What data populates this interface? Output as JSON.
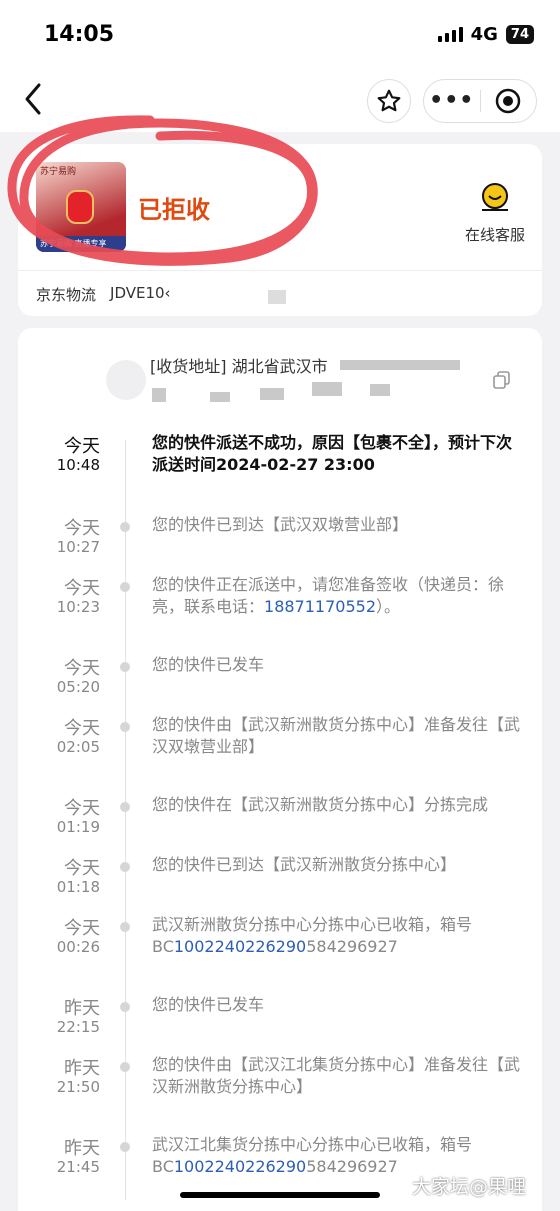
{
  "status_bar": {
    "time": "14:05",
    "network": "4G",
    "battery": "74"
  },
  "order": {
    "thumbnail_top_text": "苏宁易购",
    "thumbnail_band_text": "苏宁易购 直播专享",
    "status": "已拒收",
    "customer_service_label": "在线客服",
    "carrier": "京东物流",
    "tracking_no": "JDVE10‹"
  },
  "address": {
    "text": "[收货地址] 湖北省武汉市"
  },
  "colors": {
    "status_orange": "#e04a10",
    "link_blue": "#2c5db8",
    "scribble_red": "#e84b55"
  },
  "timeline": [
    {
      "day": "今天",
      "time": "10:48",
      "text": "您的快件派送不成功，原因【包裹不全】，预计下次派送时间2024-02-27 23:00"
    },
    {
      "day": "今天",
      "time": "10:27",
      "text": "您的快件已到达【武汉双墩营业部】"
    },
    {
      "day": "今天",
      "time": "10:23",
      "text": "您的快件正在派送中，请您准备签收（快递员：徐亮，联系电话：",
      "link": "18871170552",
      "text_after": "）。"
    },
    {
      "day": "今天",
      "time": "05:20",
      "text": "您的快件已发车"
    },
    {
      "day": "今天",
      "time": "02:05",
      "text": "您的快件由【武汉新洲散货分拣中心】准备发往【武汉双墩营业部】"
    },
    {
      "day": "今天",
      "time": "01:19",
      "text": "您的快件在【武汉新洲散货分拣中心】分拣完成"
    },
    {
      "day": "今天",
      "time": "01:18",
      "text": "您的快件已到达【武汉新洲散货分拣中心】"
    },
    {
      "day": "今天",
      "time": "00:26",
      "text": "武汉新洲散货分拣中心分拣中心已收箱，箱号BC",
      "link": "1002240226290",
      "text_after": "584296927"
    },
    {
      "day": "昨天",
      "time": "22:15",
      "text": "您的快件已发车"
    },
    {
      "day": "昨天",
      "time": "21:50",
      "text": "您的快件由【武汉江北集货分拣中心】准备发往【武汉新洲散货分拣中心】"
    },
    {
      "day": "昨天",
      "time": "21:45",
      "text": "武汉江北集货分拣中心分拣中心已收箱，箱号BC",
      "link": "1002240226290",
      "text_after": "584296927"
    }
  ],
  "watermark": "大家坛@果哩"
}
